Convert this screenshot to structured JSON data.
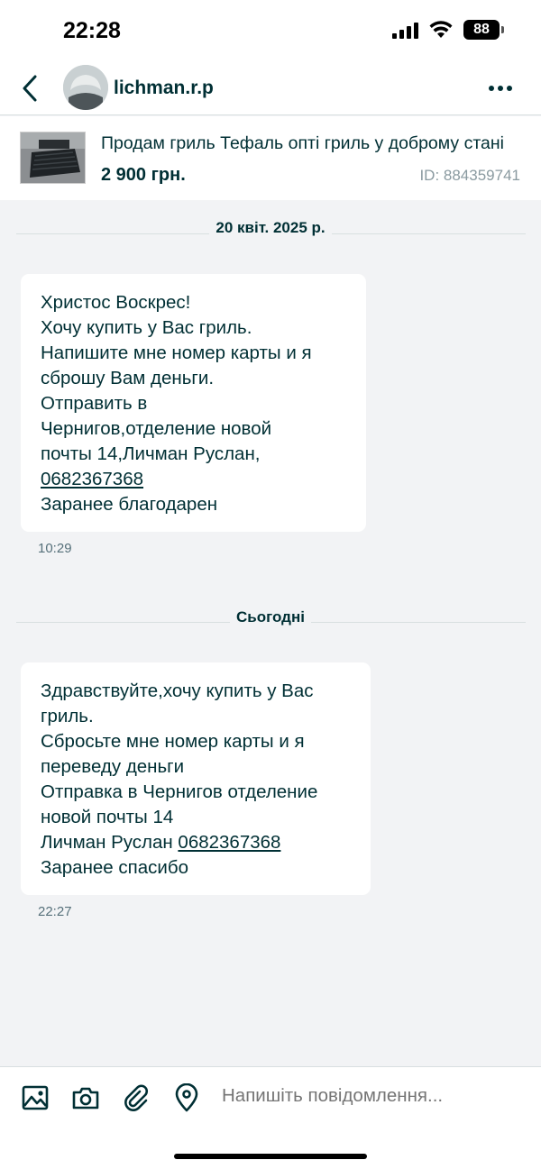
{
  "status_bar": {
    "time": "22:28",
    "battery": "88"
  },
  "header": {
    "contact_name": "lichman.r.p"
  },
  "listing": {
    "title": "Продам гриль Тефаль опті гриль у доброму стані",
    "price": "2 900 грн.",
    "id": "ID: 884359741"
  },
  "conversation": [
    {
      "date": "20 квіт. 2025 р.",
      "message": {
        "lines": [
          "Христос Воскрес!",
          "Хочу купить у Вас гриль.",
          "Напишите мне номер карты и я",
          "сброшу Вам деньги.",
          "Отправить в",
          "Чернигов,отделение новой",
          "почты 14,Личман Руслан,",
          "Заранее благодарен"
        ],
        "phone": "0682367368",
        "time": "10:29"
      }
    },
    {
      "date": "Сьогодні",
      "message": {
        "lines": [
          "Здравствуйте,хочу купить у Вас",
          "гриль.",
          "Сбросьте мне номер карты и я",
          "переведу деньги",
          "Отправка в Чернигов отделение",
          "новой почты 14",
          "Личман Руслан ",
          "Заранее спасибо"
        ],
        "phone": "0682367368",
        "time": "22:27"
      }
    }
  ],
  "composer": {
    "placeholder": "Напишіть повідомлення..."
  },
  "colors": {
    "accent": "#002f34",
    "background": "#f2f3f5",
    "bubble": "#ffffff"
  }
}
